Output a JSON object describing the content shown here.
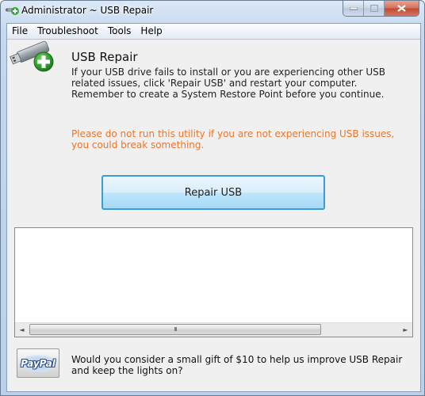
{
  "window": {
    "title": "Administrator ~ USB Repair",
    "controls": {
      "minimize": "—",
      "maximize": "□",
      "close": "✕"
    }
  },
  "menu": [
    {
      "label": "File"
    },
    {
      "label": "Troubleshoot"
    },
    {
      "label": "Tools"
    },
    {
      "label": "Help"
    }
  ],
  "header": {
    "icon": "usb-drive-add-icon",
    "title": "USB Repair",
    "description": "If your USB drive fails to install or you are experiencing other USB related issues, click 'Repair USB' and restart your computer. Remember to create a System Restore Point before you continue."
  },
  "warning": {
    "text": "Please do not run this utility if you are not experiencing USB issues, you could break something.",
    "color": "#e8772e"
  },
  "actions": {
    "repair_label": "Repair USB"
  },
  "log": {
    "content": "",
    "scroll_left": "◄",
    "scroll_right": "►",
    "thumb_grip": "III"
  },
  "donate": {
    "button_label": "PayPal",
    "text": "Would you consider a small gift of $10 to help us improve USB Repair and keep the lights on?"
  }
}
